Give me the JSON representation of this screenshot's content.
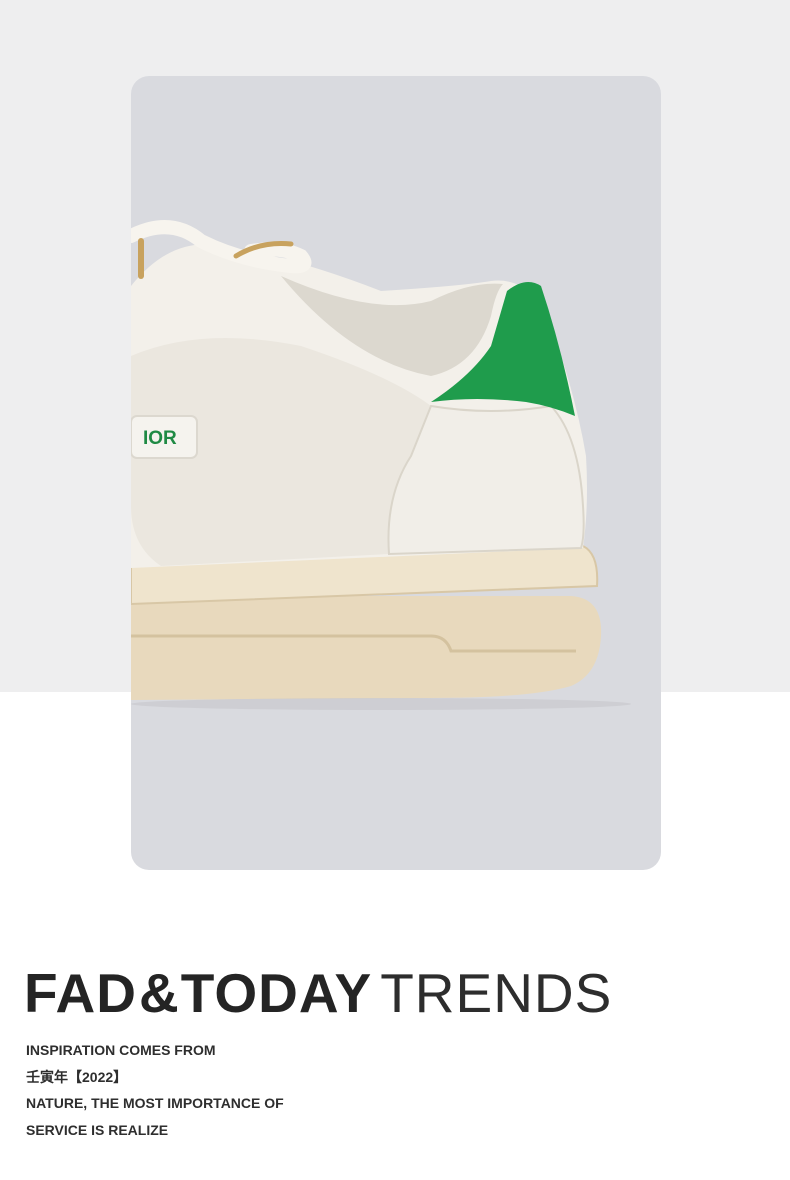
{
  "headline": {
    "part1": "FAD",
    "amp": "&",
    "part2": "TODAY",
    "part3": "TRENDS"
  },
  "copy_lines": [
    "INSPIRATION COMES FROM",
    "壬寅年【2022】",
    "NATURE, THE MOST IMPORTANCE OF",
    "SERVICE IS REALIZE"
  ],
  "shoe_label": "IOR",
  "colors": {
    "band": "#eeeeef",
    "card": "#d9dadf",
    "shoe_accent_green": "#1f9c4c",
    "sole": "#e9dcc3",
    "text": "#242424"
  }
}
